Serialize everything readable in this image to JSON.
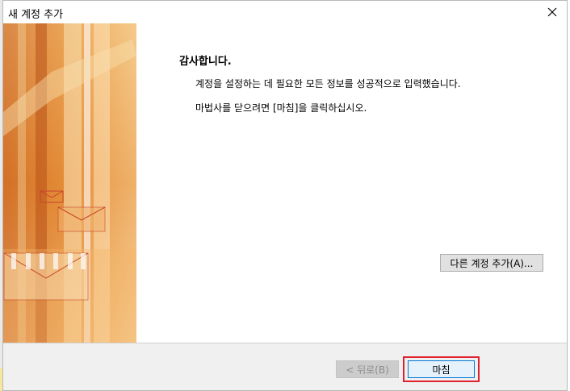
{
  "window": {
    "title": "새 계정 추가",
    "close_icon": "close-icon"
  },
  "content": {
    "heading": "감사합니다.",
    "message_1": "계정을 설정하는 데 필요한 모든 정보를 성공적으로 입력했습니다.",
    "message_2": "마법사를 닫으려면 [마침]을 클릭하십시오.",
    "add_account_label": "다른 계정 추가(A)..."
  },
  "footer": {
    "back_label": "< 뒤로(B)",
    "finish_label": "마침"
  },
  "colors": {
    "banner_orange": "#e8913a",
    "highlight_red": "#e0202e",
    "finish_border": "#0078d7"
  }
}
